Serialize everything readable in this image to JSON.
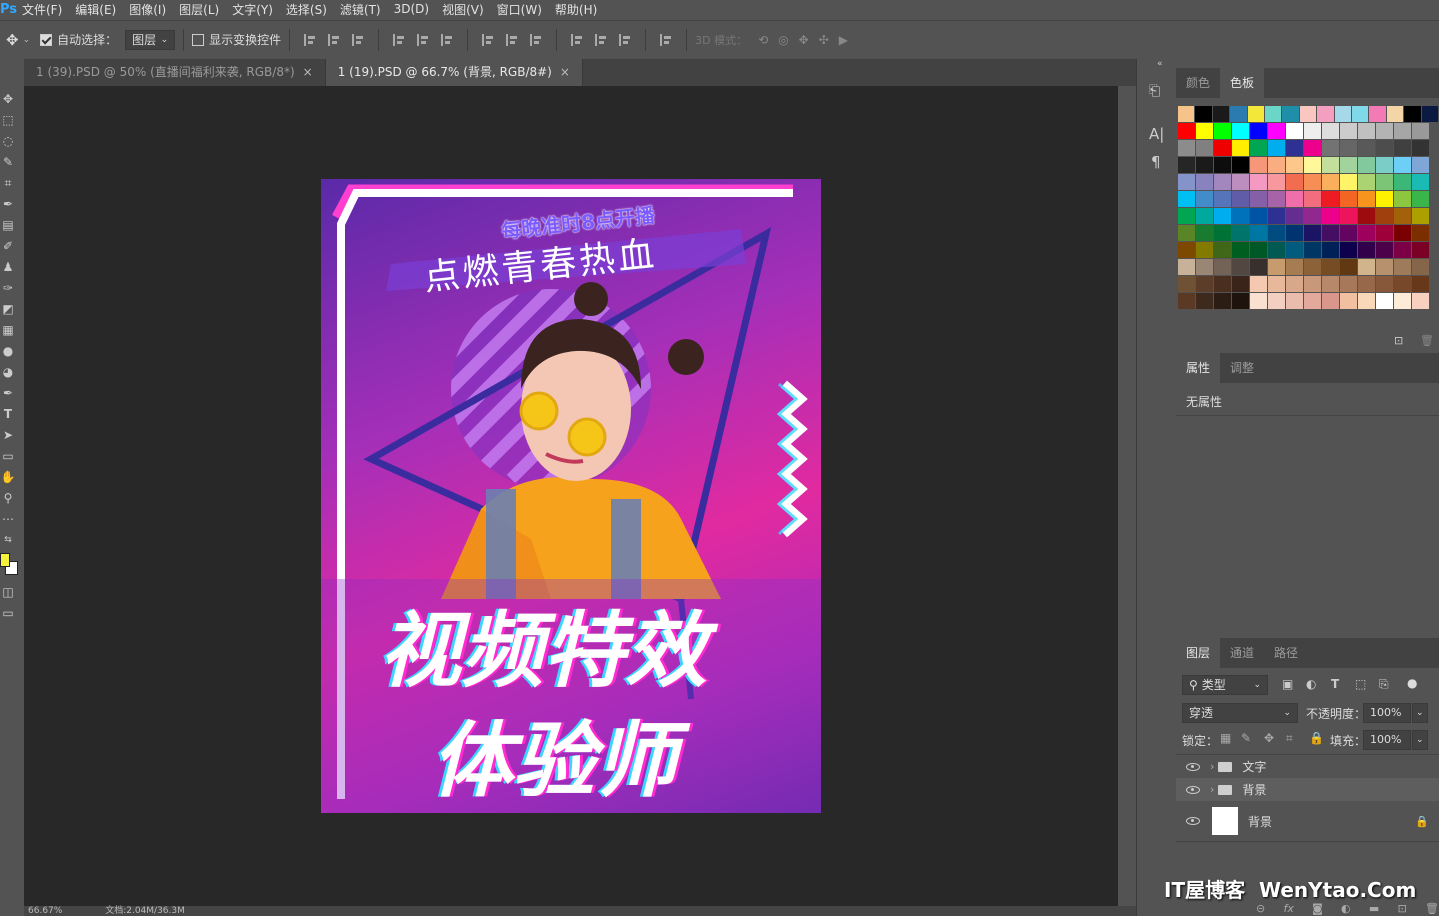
{
  "app": {
    "logo": "Ps"
  },
  "menu": [
    "文件(F)",
    "编辑(E)",
    "图像(I)",
    "图层(L)",
    "文字(Y)",
    "选择(S)",
    "滤镜(T)",
    "3D(D)",
    "视图(V)",
    "窗口(W)",
    "帮助(H)"
  ],
  "options": {
    "auto_select_label": "自动选择：",
    "auto_select_target": "图层",
    "show_transform_label": "显示变换控件",
    "mode3d_label": "3D 模式："
  },
  "tabs": [
    {
      "label": "1 (39).PSD @ 50% (直播间福利来袭, RGB/8*)",
      "close": "×"
    },
    {
      "label": "1 (19).PSD @ 66.7% (背景, RGB/8#)",
      "close": "×"
    }
  ],
  "poster": {
    "line1": "每晚准时8点开播",
    "line2": "点燃青春热血",
    "title1": "视频特效",
    "title2": "体验师"
  },
  "swatches_panel": {
    "tab_color": "颜色",
    "tab_swatches": "色板"
  },
  "swatch_rows": [
    [
      "#f6c38b",
      "#000000",
      "#1a1a1a",
      "#2b7bb0",
      "#f3e73a",
      "#6bd5c8",
      "#1f8ea8",
      "#f9c6c0",
      "#f59fc0",
      "#a5d8e8",
      "#7fd9e8",
      "#f37bb5",
      "#f4d5a8",
      "#000000",
      "#0a1a40"
    ],
    [
      "#ff0000",
      "#ffff00",
      "#00ff00",
      "#00ffff",
      "#0000ff",
      "#ff00ff",
      "#ffffff",
      "#eeeeee",
      "#dddddd",
      "#cccccc",
      "#c0c0c0",
      "#b3b3b3",
      "#a6a6a6",
      "#999999"
    ],
    [
      "#8c8c8c",
      "#808080",
      "#ee0000",
      "#ffee00",
      "#00a651",
      "#00aeef",
      "#2e3192",
      "#ec008c",
      "#737373",
      "#666666",
      "#595959",
      "#4d4d4d",
      "#404040",
      "#333333"
    ],
    [
      "#262626",
      "#1a1a1a",
      "#0d0d0d",
      "#000000",
      "#f7977a",
      "#f9ad81",
      "#fdc68a",
      "#fff79a",
      "#c4df9b",
      "#a2d39c",
      "#82ca9d",
      "#7bcdc8",
      "#6ecff6",
      "#7ea7d8"
    ],
    [
      "#8493ca",
      "#8882be",
      "#a187be",
      "#bc8dbf",
      "#f49ac2",
      "#f6989d",
      "#f26c4f",
      "#f68e55",
      "#fbaf5c",
      "#fff467",
      "#acd372",
      "#7cc576",
      "#3bb878",
      "#1abbb4"
    ],
    [
      "#00bff3",
      "#438cca",
      "#5574b9",
      "#605ca8",
      "#855fa8",
      "#a763a8",
      "#f06ea9",
      "#f26d7d",
      "#ed1c24",
      "#f26522",
      "#f7941d",
      "#fff200",
      "#8dc73f",
      "#39b54a"
    ],
    [
      "#00a651",
      "#00a99d",
      "#00aeef",
      "#0072bc",
      "#0054a6",
      "#2e3192",
      "#662d91",
      "#92278f",
      "#ec008c",
      "#ed145b",
      "#9e0b0f",
      "#a0410d",
      "#a36209",
      "#aba000"
    ],
    [
      "#598527",
      "#197b30",
      "#007236",
      "#00746b",
      "#0076a3",
      "#004b80",
      "#003471",
      "#1b1464",
      "#440e62",
      "#630460",
      "#9e005d",
      "#9e0039",
      "#790000",
      "#7b2e00"
    ],
    [
      "#7d4900",
      "#827b00",
      "#406618",
      "#005e20",
      "#005826",
      "#005952",
      "#005b7f",
      "#003663",
      "#002157",
      "#0d004c",
      "#32004b",
      "#4b0049",
      "#7b0046",
      "#7a0026"
    ],
    [
      "#c7b299",
      "#998675",
      "#736357",
      "#534741",
      "#37302d",
      "#c69c6d",
      "#a67c52",
      "#8c6239",
      "#754c24",
      "#603913",
      "#d2b48c",
      "#b7916e",
      "#9e7b5b",
      "#85664a"
    ],
    [
      "#6f5136",
      "#5c3d2a",
      "#4a2e1f",
      "#3a2318",
      "#f5c8b0",
      "#e8b89a",
      "#d9a88a",
      "#c9987a",
      "#b8886a",
      "#a8785a",
      "#98684a",
      "#88583a",
      "#78482a",
      "#68381a"
    ],
    [
      "#5a3a25",
      "#3d2a1c",
      "#2b1d14",
      "#1f140d",
      "#f9e0d0",
      "#f2cfc0",
      "#eabcae",
      "#e2a99c",
      "#d9968a",
      "#f0c0a0",
      "#f8d8b8",
      "#ffffff",
      "#fcecd8",
      "#f8d0c0"
    ]
  ],
  "properties_panel": {
    "tab_props": "属性",
    "tab_adjust": "调整",
    "empty": "无属性"
  },
  "layers_panel": {
    "tab_layers": "图层",
    "tab_channels": "通道",
    "tab_paths": "路径",
    "filter_label": "类型",
    "blend_mode": "穿透",
    "opacity_label": "不透明度：",
    "opacity_value": "100%",
    "lock_label": "锁定：",
    "fill_label": "填充：",
    "fill_value": "100%",
    "layers": [
      {
        "name": "文字",
        "type": "group"
      },
      {
        "name": "背景",
        "type": "group"
      },
      {
        "name": "背景",
        "type": "background"
      }
    ]
  },
  "status": {
    "zoom": "66.67%",
    "doc": "文档:2.04M/36.3M"
  },
  "watermark": "IT屋博客  WenYtao.Com",
  "colors": {
    "accent": "#31a8ff",
    "fg_swatch": "#f5f03a",
    "bg_swatch": "#ffffff"
  }
}
